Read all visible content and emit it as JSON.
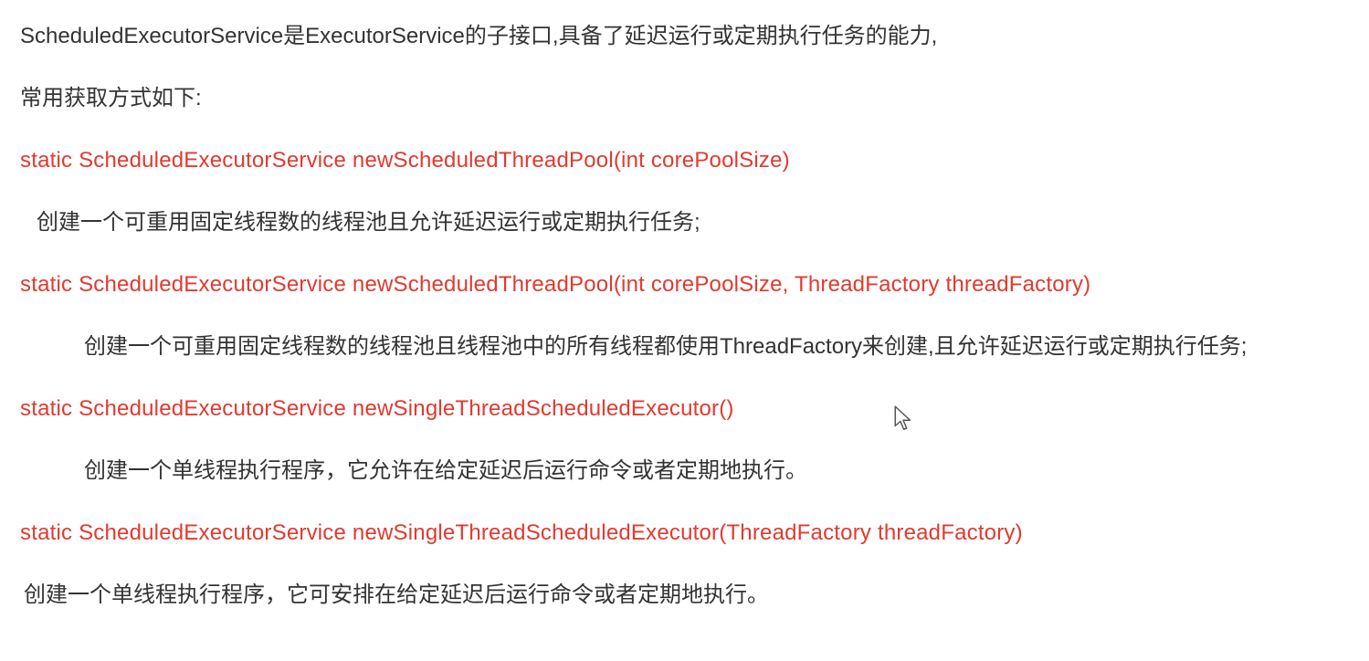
{
  "intro": "ScheduledExecutorService是ExecutorService的子接口,具备了延迟运行或定期执行任务的能力,",
  "subintro": "常用获取方式如下:",
  "methods": [
    {
      "signature": "static ScheduledExecutorService newScheduledThreadPool(int corePoolSize)",
      "description": "创建一个可重用固定线程数的线程池且允许延迟运行或定期执行任务;",
      "indent": "small"
    },
    {
      "signature": "static ScheduledExecutorService newScheduledThreadPool(int corePoolSize, ThreadFactory threadFactory)",
      "description": "创建一个可重用固定线程数的线程池且线程池中的所有线程都使用ThreadFactory来创建,且允许延迟运行或定期执行任务;",
      "indent": "large"
    },
    {
      "signature": "static ScheduledExecutorService newSingleThreadScheduledExecutor()",
      "description": "创建一个单线程执行程序，它允许在给定延迟后运行命令或者定期地执行。",
      "indent": "large"
    },
    {
      "signature": "static ScheduledExecutorService newSingleThreadScheduledExecutor(ThreadFactory threadFactory)",
      "description": "创建一个单线程执行程序，它可安排在给定延迟后运行命令或者定期地执行。",
      "indent": "none"
    }
  ]
}
